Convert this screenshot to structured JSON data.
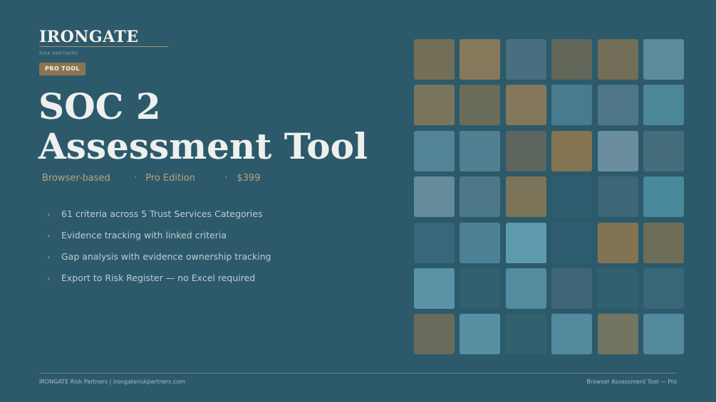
{
  "brand": {
    "name": "IRONGATE",
    "subtitle": "RISK PARTNERS"
  },
  "badge": "PRO TOOL",
  "title": {
    "line1": "SOC 2",
    "line2": "Assessment Tool"
  },
  "meta": {
    "item1": "Browser-based",
    "sep1": "·",
    "item2": "Pro Edition",
    "sep2": "·",
    "item3": "$399"
  },
  "features": [
    "61 criteria across 5 Trust Services Categories",
    "Evidence tracking with linked criteria",
    "Gap analysis with evidence ownership tracking",
    "Export to Risk Register — no Excel required"
  ],
  "bullet_icon": "chevron-right-icon",
  "mosaic": {
    "rows": [
      [
        "#756e57",
        "#86785b",
        "#476f80",
        "#636759",
        "#716d57",
        "#5e8b9a"
      ],
      [
        "#7b755d",
        "#6b6b59",
        "#85775c",
        "#487b8d",
        "#4f7687",
        "#4c8699"
      ],
      [
        "#528396",
        "#527f91",
        "#5c655e",
        "#847451",
        "#6a8e9d",
        "#466d7c"
      ],
      [
        "#648c9a",
        "#4d7889",
        "#7c7459",
        "#2e5e70",
        "#3d6677",
        "#4a889b"
      ],
      [
        "#376778",
        "#4c8196",
        "#5d9aad",
        "#2f5e70",
        "#827452",
        "#6e6d58"
      ],
      [
        "#5b93a6",
        "#31606f",
        "#538c9f",
        "#3e6678",
        "#31606f",
        "#386878"
      ],
      [
        "#686b5b",
        "#5890a3",
        "#31606f",
        "#538b9e",
        "#737560",
        "#538a9d"
      ]
    ]
  },
  "footer": {
    "left": "IRONGATE Risk Partners | irongateriskpartners.com",
    "right": "Browser Assessment Tool — Pro"
  },
  "colors": {
    "background": "#2c5a6b",
    "accent_gold": "#b9a37d",
    "badge_bg": "#8b7555"
  }
}
